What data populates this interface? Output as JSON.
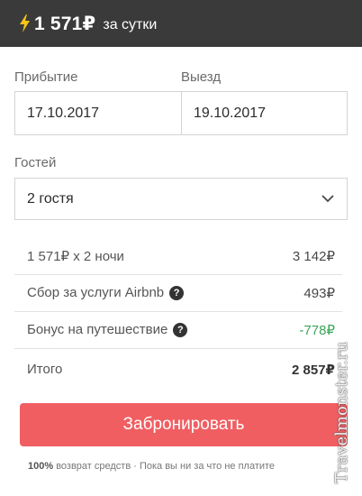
{
  "header": {
    "price": "1 571₽",
    "per_label": "за сутки",
    "bg_color": "#3a3a3a",
    "accent_color": "#f5c518"
  },
  "dates": {
    "checkin_label": "Прибытие",
    "checkout_label": "Выезд",
    "checkin_value": "17.10.2017",
    "checkout_value": "19.10.2017"
  },
  "guests": {
    "label": "Гостей",
    "value": "2 гостя"
  },
  "breakdown": {
    "nights_label": "1 571₽ x 2 ночи",
    "nights_value": "3 142₽",
    "service_label": "Сбор за услуги Airbnb",
    "service_value": "493₽",
    "bonus_label": "Бонус на путешествие",
    "bonus_value": "-778₽",
    "total_label": "Итого",
    "total_value": "2 857₽"
  },
  "book_button": {
    "label": "Забронировать",
    "color": "#f05e62"
  },
  "footnote": {
    "bold": "100%",
    "text": "возврат средств · Пока вы ни за что не платите"
  },
  "watermark": "Travelmonster.ru"
}
